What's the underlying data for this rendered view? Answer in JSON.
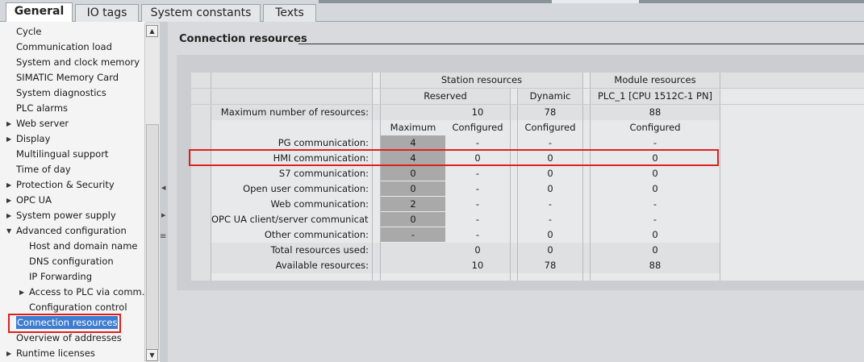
{
  "tabs": [
    "General",
    "IO tags",
    "System constants",
    "Texts"
  ],
  "sidebar": {
    "items": [
      {
        "label": "Cycle",
        "indent": 0,
        "arrow": false
      },
      {
        "label": "Communication load",
        "indent": 0,
        "arrow": false
      },
      {
        "label": "System and clock memory",
        "indent": 0,
        "arrow": false
      },
      {
        "label": "SIMATIC Memory Card",
        "indent": 0,
        "arrow": false
      },
      {
        "label": "System diagnostics",
        "indent": 0,
        "arrow": false
      },
      {
        "label": "PLC alarms",
        "indent": 0,
        "arrow": false
      },
      {
        "label": "Web server",
        "indent": 0,
        "arrow": true
      },
      {
        "label": "Display",
        "indent": 0,
        "arrow": true
      },
      {
        "label": "Multilingual support",
        "indent": 0,
        "arrow": false
      },
      {
        "label": "Time of day",
        "indent": 0,
        "arrow": false
      },
      {
        "label": "Protection & Security",
        "indent": 0,
        "arrow": true
      },
      {
        "label": "OPC UA",
        "indent": 0,
        "arrow": true
      },
      {
        "label": "System power supply",
        "indent": 0,
        "arrow": true
      },
      {
        "label": "Advanced configuration",
        "indent": 0,
        "arrow": "open"
      },
      {
        "label": "Host and domain name",
        "indent": 1,
        "arrow": false
      },
      {
        "label": "DNS configuration",
        "indent": 1,
        "arrow": false
      },
      {
        "label": "IP Forwarding",
        "indent": 1,
        "arrow": false
      },
      {
        "label": "Access to PLC via comm...",
        "indent": 1,
        "arrow": true
      },
      {
        "label": "Configuration control",
        "indent": 1,
        "arrow": false
      },
      {
        "label": "Connection resources",
        "indent": 0,
        "arrow": false,
        "selected": true
      },
      {
        "label": "Overview of addresses",
        "indent": 0,
        "arrow": false
      },
      {
        "label": "Runtime licenses",
        "indent": 0,
        "arrow": true
      }
    ]
  },
  "section": {
    "title": "Connection resources"
  },
  "table": {
    "group_station": "Station resources",
    "group_module": "Module resources",
    "sub_reserved": "Reserved",
    "sub_dynamic": "Dynamic",
    "sub_plc": "PLC_1 [CPU 1512C-1 PN]",
    "max_label": "Maximum number of resources:",
    "max_reserved": "10",
    "max_dynamic": "78",
    "max_module": "88",
    "col_maximum": "Maximum",
    "col_configured_reserved": "Configured",
    "col_configured_dynamic": "Configured",
    "col_configured_module": "Configured",
    "rows": [
      {
        "label": "PG communication:",
        "maximum": "4",
        "configured": "-",
        "dynamic": "-",
        "module": "-"
      },
      {
        "label": "HMI communication:",
        "maximum": "4",
        "configured": "0",
        "dynamic": "0",
        "module": "0"
      },
      {
        "label": "S7 communication:",
        "maximum": "0",
        "configured": "-",
        "dynamic": "0",
        "module": "0"
      },
      {
        "label": "Open user communication:",
        "maximum": "0",
        "configured": "-",
        "dynamic": "0",
        "module": "0"
      },
      {
        "label": "Web communication:",
        "maximum": "2",
        "configured": "-",
        "dynamic": "-",
        "module": "-"
      },
      {
        "label": "OPC UA client/server communicati...",
        "maximum": "0",
        "configured": "-",
        "dynamic": "-",
        "module": "-"
      },
      {
        "label": "Other communication:",
        "maximum": "-",
        "configured": "-",
        "dynamic": "0",
        "module": "0"
      }
    ],
    "total_label": "Total resources used:",
    "total_reserved": "0",
    "total_dynamic": "0",
    "total_module": "0",
    "avail_label": "Available resources:",
    "avail_reserved": "10",
    "avail_dynamic": "78",
    "avail_module": "88"
  }
}
